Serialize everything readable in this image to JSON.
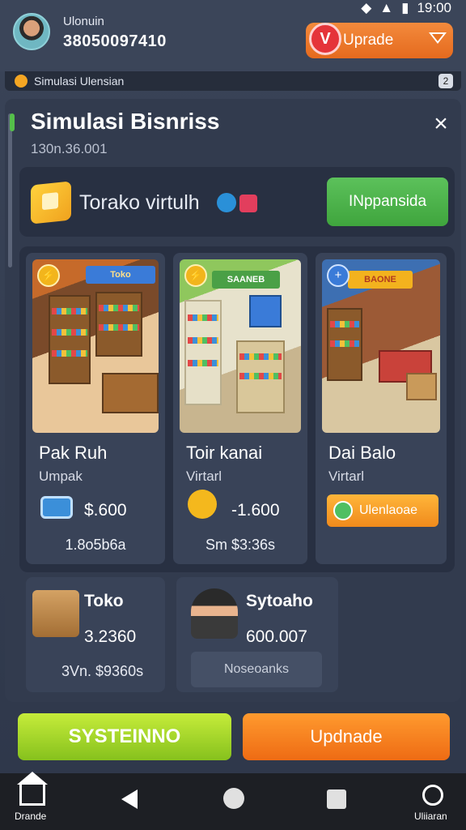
{
  "status": {
    "time": "19:00"
  },
  "user": {
    "name": "Ulonuin",
    "id": "38050097410"
  },
  "upgrade": {
    "label": "Uprade",
    "badge": "V"
  },
  "notice": {
    "text": "Simulasi Ulensian",
    "count": "2"
  },
  "panel": {
    "title": "Simulasi Bisnriss",
    "subtitle": "130n.36.001",
    "close": "×"
  },
  "feature": {
    "label": "Torako virtulh",
    "button": "INppansida"
  },
  "cards": [
    {
      "title": "Pak Ruh",
      "sub": "Umpak",
      "price": "$.600",
      "foot": "1.8o5b6a",
      "sign": "Toko",
      "badge": "⚡"
    },
    {
      "title": "Toir kanai",
      "sub": "Virtarl",
      "price": "-1.600",
      "foot": "Sm  $3:36s",
      "sign": "SAANEB",
      "badge": "⚡"
    },
    {
      "title": "Dai Balo",
      "sub": "Virtarl",
      "button": "Ulenlaoae",
      "sign": "BAONE",
      "badge": "+"
    }
  ],
  "mini": [
    {
      "title": "Toko",
      "value": "3.2360",
      "foot": "3Vn. $9360s"
    },
    {
      "title": "Sytoaho",
      "value": "600.007",
      "field": "Noseoanks"
    }
  ],
  "actions": {
    "primary": "SYSTEINNO",
    "secondary": "Updnade"
  },
  "nav": {
    "left_label": "Drande",
    "right_label": "Uliiaran"
  }
}
